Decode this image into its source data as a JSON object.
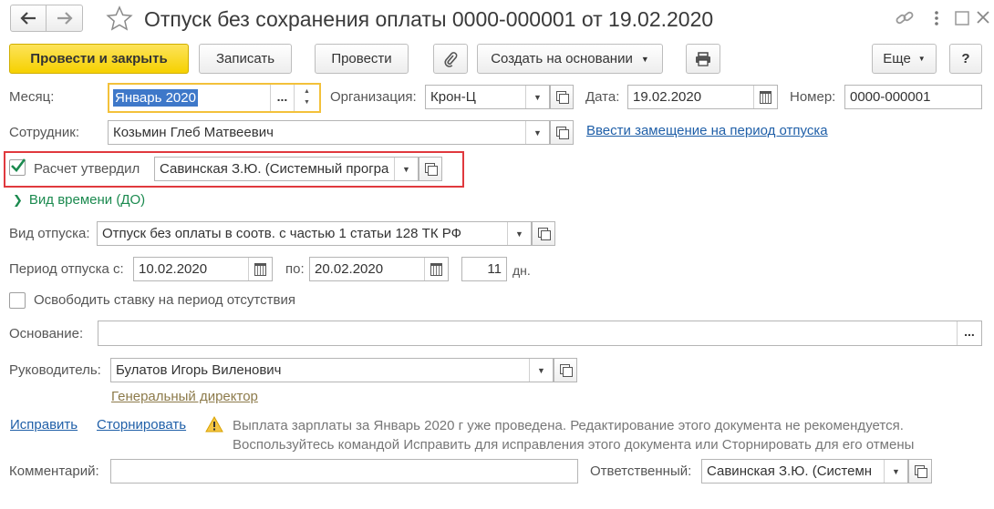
{
  "title": "Отпуск без сохранения оплаты 0000-000001 от 19.02.2020",
  "toolbar": {
    "post_close": "Провести и закрыть",
    "save": "Записать",
    "post": "Провести",
    "create_based": "Создать на основании",
    "more": "Еще",
    "help": "?"
  },
  "form": {
    "month_label": "Месяц:",
    "month_value": "Январь 2020",
    "month_select": "...",
    "org_label": "Организация:",
    "org_value": "Крон-Ц",
    "date_label": "Дата:",
    "date_value": "19.02.2020",
    "number_label": "Номер:",
    "number_value": "0000-000001",
    "employee_label": "Сотрудник:",
    "employee_value": "Козьмин Глеб Матвеевич",
    "replacement_link": "Ввести замещение на период отпуска",
    "approved_label": "Расчет утвердил",
    "approved_checked": true,
    "approved_value": "Савинская З.Ю. (Системный програ",
    "time_type_toggle": "Вид времени (ДО)",
    "leave_type_label": "Вид отпуска:",
    "leave_type_value": "Отпуск без оплаты в соотв. с частью 1 статьи 128 ТК РФ",
    "period_label": "Период отпуска с:",
    "period_from": "10.02.2020",
    "period_to_label": "по:",
    "period_to": "20.02.2020",
    "days_value": "11",
    "days_unit": "дн.",
    "release_rate_label": "Освободить ставку на период отсутствия",
    "basis_label": "Основание:",
    "basis_value": "",
    "basis_select": "...",
    "manager_label": "Руководитель:",
    "manager_value": "Булатов Игорь Виленович",
    "manager_position": "Генеральный директор",
    "fix_link": "Исправить",
    "reverse_link": "Сторнировать",
    "warning_line1": "Выплата зарплаты за Январь 2020 г уже проведена. Редактирование этого документа не рекомендуется.",
    "warning_line2": "Воспользуйтесь командой Исправить для исправления этого документа или Сторнировать для его отмены",
    "comment_label": "Комментарий:",
    "comment_value": "",
    "responsible_label": "Ответственный:",
    "responsible_value": "Савинская З.Ю. (Системн"
  },
  "colors": {
    "primary_button": "#f6d100",
    "link": "#1f5fa8",
    "highlight_border": "#e0393e",
    "group_toggle": "#1b8a4f",
    "active_field_border": "#f3c13a"
  }
}
